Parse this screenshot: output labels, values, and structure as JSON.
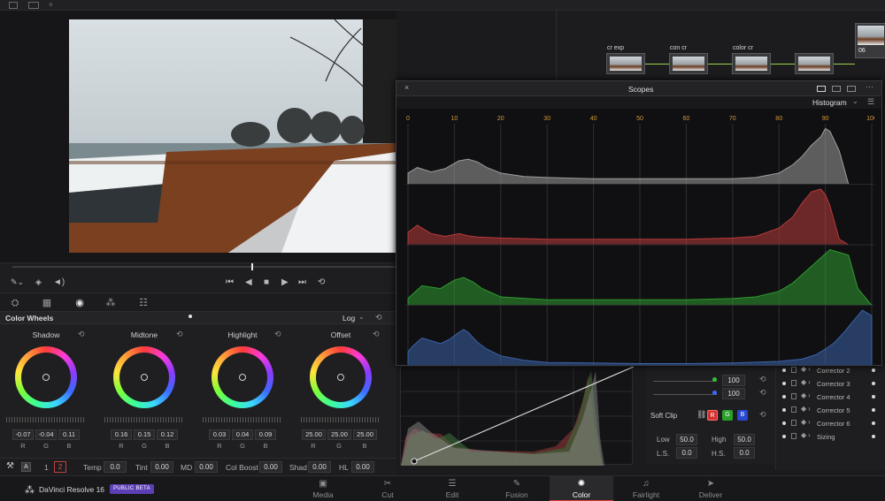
{
  "app": {
    "name": "DaVinci Resolve 16",
    "badge": "PUBLIC BETA"
  },
  "pages": [
    {
      "label": "Media",
      "glyph": "▣"
    },
    {
      "label": "Cut",
      "glyph": "✂"
    },
    {
      "label": "Edit",
      "glyph": "☰"
    },
    {
      "label": "Fusion",
      "glyph": "✎"
    },
    {
      "label": "Color",
      "glyph": "✺"
    },
    {
      "label": "Fairlight",
      "glyph": "♫"
    },
    {
      "label": "Deliver",
      "glyph": "➤"
    }
  ],
  "active_page": "Color",
  "nodes": {
    "labels": [
      "cr exp",
      "con cr",
      "color cr"
    ],
    "clip_label": "06"
  },
  "scopes": {
    "title": "Scopes",
    "mode": "Histogram",
    "scale_ticks": [
      "0",
      "10",
      "20",
      "30",
      "40",
      "50",
      "60",
      "70",
      "80",
      "90",
      "100"
    ]
  },
  "color_wheels": {
    "title": "Color Wheels",
    "mode": "Log",
    "wheels": [
      {
        "name": "Shadow",
        "values": [
          "-0.07",
          "-0.04",
          "0.11"
        ]
      },
      {
        "name": "Midtone",
        "values": [
          "0.16",
          "0.15",
          "0.12"
        ]
      },
      {
        "name": "Highlight",
        "values": [
          "0.03",
          "0.04",
          "0.09"
        ]
      },
      {
        "name": "Offset",
        "values": [
          "25.00",
          "25.00",
          "25.00"
        ]
      }
    ],
    "channels": [
      "R",
      "G",
      "B"
    ]
  },
  "params": {
    "page_1": "1",
    "page_2": "2",
    "temp_label": "Temp",
    "temp": "0.0",
    "tint_label": "Tint",
    "tint": "0.00",
    "md_label": "MD",
    "md": "0.00",
    "colboost_label": "Col Boost",
    "colboost": "0.00",
    "shad_label": "Shad",
    "shad": "0.00",
    "hl_label": "HL",
    "hl": "0.00"
  },
  "curves_panel": {
    "intensity_g": "100",
    "intensity_b": "100",
    "soft_clip_label": "Soft Clip",
    "channel_r": "R",
    "channel_g": "G",
    "channel_b": "B",
    "low_label": "Low",
    "low": "50.0",
    "high_label": "High",
    "high": "50.0",
    "ls_label": "L.S.",
    "ls": "0.0",
    "hs_label": "H.S.",
    "hs": "0.0"
  },
  "layers": [
    "Corrector 2",
    "Corrector 3",
    "Corrector 4",
    "Corrector 5",
    "Corrector 6",
    "Sizing"
  ],
  "chart_data": {
    "type": "area",
    "title": "Histogram",
    "x_range": [
      0,
      100
    ],
    "x_ticks": [
      0,
      10,
      20,
      30,
      40,
      50,
      60,
      70,
      80,
      90,
      100
    ],
    "series": [
      {
        "name": "",
        "color": "#9c9c9c",
        "x": [
          0,
          2,
          5,
          8,
          11,
          13,
          15,
          17,
          20,
          25,
          30,
          40,
          50,
          60,
          70,
          75,
          80,
          83,
          85,
          87,
          89,
          90,
          91,
          93,
          95,
          97,
          100
        ],
        "values": [
          0.2,
          0.3,
          0.22,
          0.28,
          0.42,
          0.45,
          0.4,
          0.3,
          0.2,
          0.14,
          0.12,
          0.1,
          0.1,
          0.1,
          0.1,
          0.12,
          0.2,
          0.35,
          0.5,
          0.7,
          0.85,
          1.0,
          0.95,
          0.6,
          0,
          0,
          0
        ]
      },
      {
        "name": "",
        "color": "#b83a3a",
        "x": [
          0,
          2,
          5,
          8,
          11,
          13,
          15,
          20,
          30,
          40,
          50,
          60,
          70,
          75,
          80,
          83,
          85,
          87,
          89,
          90,
          91,
          93,
          95,
          100
        ],
        "values": [
          0.22,
          0.35,
          0.2,
          0.15,
          0.2,
          0.16,
          0.14,
          0.12,
          0.1,
          0.1,
          0.1,
          0.1,
          0.12,
          0.15,
          0.3,
          0.5,
          0.75,
          0.95,
          1.0,
          0.9,
          0.7,
          0.1,
          0,
          0
        ]
      },
      {
        "name": "",
        "color": "#2f9a2f",
        "x": [
          0,
          3,
          7,
          10,
          12,
          14,
          16,
          20,
          30,
          40,
          50,
          60,
          70,
          75,
          80,
          83,
          85,
          87,
          89,
          91,
          93,
          95,
          97,
          100
        ],
        "values": [
          0.12,
          0.35,
          0.3,
          0.45,
          0.5,
          0.42,
          0.3,
          0.15,
          0.1,
          0.1,
          0.1,
          0.1,
          0.12,
          0.15,
          0.25,
          0.4,
          0.55,
          0.7,
          0.85,
          1.0,
          0.95,
          0.9,
          0.3,
          0
        ]
      },
      {
        "name": "",
        "color": "#3b62a8",
        "x": [
          0,
          1,
          3,
          5,
          7,
          9,
          11,
          12,
          13,
          15,
          17,
          20,
          25,
          30,
          40,
          50,
          60,
          70,
          80,
          85,
          88,
          90,
          92,
          94,
          96,
          98,
          100
        ],
        "values": [
          0.25,
          0.35,
          0.5,
          0.45,
          0.4,
          0.48,
          0.6,
          0.65,
          0.6,
          0.42,
          0.3,
          0.18,
          0.1,
          0.06,
          0.05,
          0.04,
          0.04,
          0.05,
          0.08,
          0.12,
          0.2,
          0.3,
          0.42,
          0.6,
          0.8,
          1.0,
          0.9
        ]
      }
    ]
  }
}
